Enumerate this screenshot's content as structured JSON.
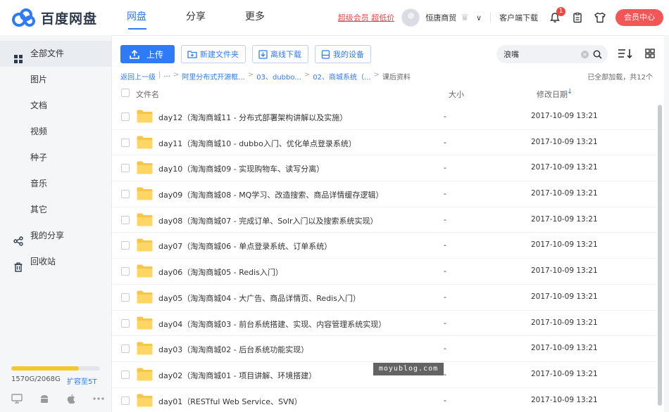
{
  "app": {
    "brand": "百度网盘",
    "nav": [
      {
        "label": "网盘",
        "active": true
      },
      {
        "label": "分享",
        "active": false
      },
      {
        "label": "更多",
        "active": false
      }
    ],
    "vip_link": "超级会员 超低价",
    "username": "恒唐商贸",
    "client_download": "客户端下载",
    "notification_count": "1",
    "member_center": "会员中心",
    "accent_color": "#2f7bf5"
  },
  "sidebar": {
    "items": [
      {
        "label": "全部文件",
        "icon": "file-icon",
        "active": true
      },
      {
        "label": "图片",
        "icon": "",
        "active": false
      },
      {
        "label": "文档",
        "icon": "",
        "active": false
      },
      {
        "label": "视频",
        "icon": "",
        "active": false
      },
      {
        "label": "种子",
        "icon": "",
        "active": false
      },
      {
        "label": "音乐",
        "icon": "",
        "active": false
      },
      {
        "label": "其它",
        "icon": "",
        "active": false
      },
      {
        "label": "我的分享",
        "icon": "share-icon",
        "active": false
      },
      {
        "label": "回收站",
        "icon": "trash-icon",
        "active": false
      }
    ],
    "quota_used": "1570G/2068G",
    "quota_fraction": 0.76,
    "quota_expand": "扩容至5T"
  },
  "toolbar": {
    "upload": "上传",
    "new_folder": "新建文件夹",
    "offline_download": "离线下载",
    "my_devices": "我的设备",
    "search_value": "浪嘴"
  },
  "breadcrumb": {
    "back": "返回上一级",
    "items": [
      "...",
      "阿里分布式开源框...",
      "03、dubbo...",
      "02、商城系统（..."
    ],
    "current": "课后资料",
    "loaded_info": "已全部加载，共12个"
  },
  "columns": {
    "name": "文件名",
    "size": "大小",
    "date": "修改日期"
  },
  "files": [
    {
      "name": "day12（淘淘商城11 - 分布式部署架构讲解以及实施）",
      "size": "-",
      "date": "2017-10-09 13:21"
    },
    {
      "name": "day11（淘淘商城10 - dubbo入门、优化单点登录系统）",
      "size": "-",
      "date": "2017-10-09 13:21"
    },
    {
      "name": "day10（淘淘商城09 - 实现购物车、读写分离）",
      "size": "-",
      "date": "2017-10-09 13:21"
    },
    {
      "name": "day09（淘淘商城08 - MQ学习、改造搜索、商品详情缓存逻辑）",
      "size": "-",
      "date": "2017-10-09 13:21"
    },
    {
      "name": "day08（淘淘商城07 - 完成订单、Solr入门以及搜索系统实现）",
      "size": "-",
      "date": "2017-10-09 13:21"
    },
    {
      "name": "day07（淘淘商城06 - 单点登录系统、订单系统）",
      "size": "-",
      "date": "2017-10-09 13:21"
    },
    {
      "name": "day06（淘淘商城05 - Redis入门）",
      "size": "-",
      "date": "2017-10-09 13:21"
    },
    {
      "name": "day05（淘淘商城04 - 大广告、商品详情页、Redis入门）",
      "size": "-",
      "date": "2017-10-09 13:21"
    },
    {
      "name": "day04（淘淘商城03 - 前台系统搭建、实现、内容管理系统实现）",
      "size": "-",
      "date": "2017-10-09 13:21"
    },
    {
      "name": "day03（淘淘商城02 - 后台系统功能实现）",
      "size": "-",
      "date": "2017-10-09 13:21"
    },
    {
      "name": "day02（淘淘商城01 - 项目讲解、环境搭建）",
      "size": "-",
      "date": "2017-10-09 13:21"
    },
    {
      "name": "day01（RESTful Web Service、SVN）",
      "size": "-",
      "date": "2017-10-09 13:21"
    }
  ],
  "watermark": "moyublog.com"
}
